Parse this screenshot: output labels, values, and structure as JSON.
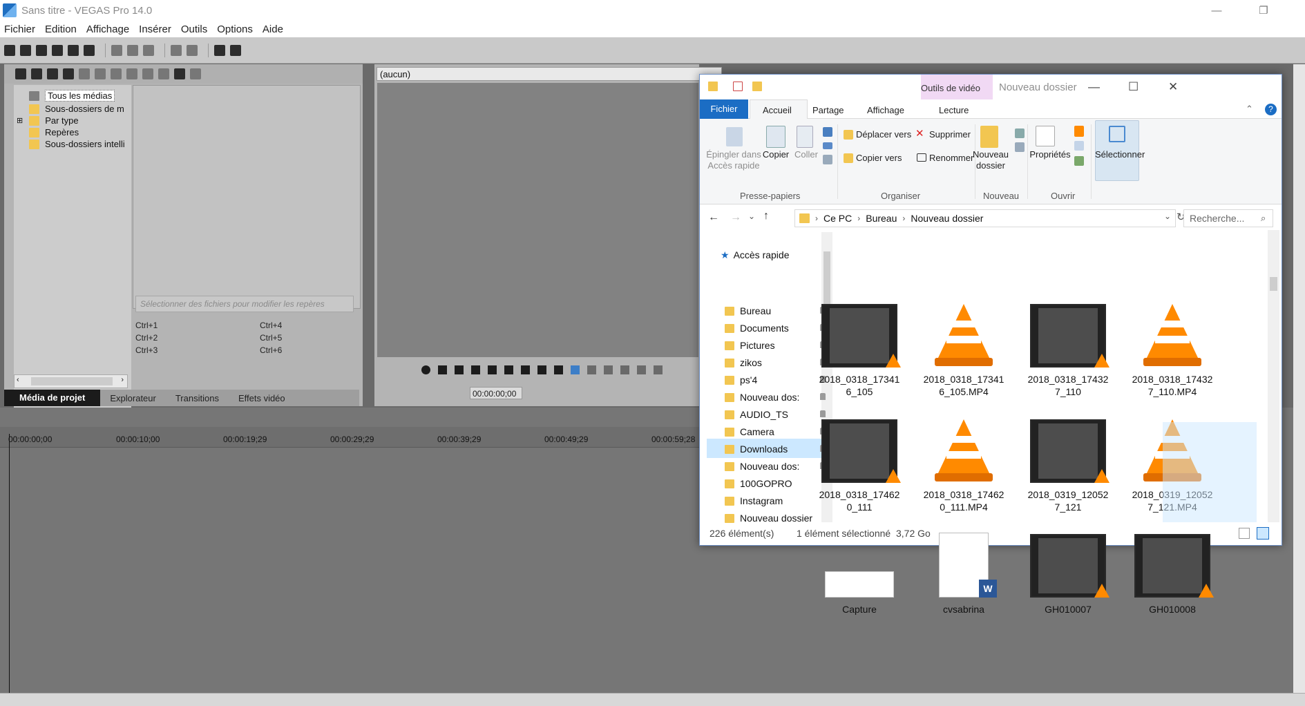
{
  "vegas": {
    "title": "Sans titre - VEGAS Pro 14.0",
    "menu": [
      "Fichier",
      "Edition",
      "Affichage",
      "Insérer",
      "Outils",
      "Options",
      "Aide"
    ],
    "tree": {
      "root": "Tous les médias",
      "items": [
        "Sous-dossiers de m",
        "Par type",
        "Repères",
        "Sous-dossiers intelli"
      ]
    },
    "markers_placeholder": "Sélectionner des fichiers pour modifier les repères",
    "shortcuts": [
      "Ctrl+1",
      "Ctrl+4",
      "Ctrl+2",
      "Ctrl+5",
      "Ctrl+3",
      "Ctrl+6"
    ],
    "tabs": [
      "Média de projet",
      "Explorateur",
      "Transitions",
      "Effets vidéo"
    ],
    "preview_selector": "(aucun)",
    "timecode": "00:00:00;00",
    "ruler": [
      "00:00:00;00",
      "00:00:10;00",
      "00:00:19;29",
      "00:00:29;29",
      "00:00:39;29",
      "00:00:49;29",
      "00:00:59;28"
    ]
  },
  "explorer": {
    "title": "Nouveau dossier",
    "context_tab": "Outils de vidéo",
    "ribbon_tabs": [
      "Fichier",
      "Accueil",
      "Partage",
      "Affichage",
      "Lecture"
    ],
    "ribbon": {
      "pin": "Épingler dans Accès rapide",
      "copy": "Copier",
      "paste": "Coller",
      "move_to": "Déplacer vers",
      "copy_to": "Copier vers",
      "delete": "Supprimer",
      "rename": "Renommer",
      "new_folder": "Nouveau dossier",
      "properties": "Propriétés",
      "select": "Sélectionner",
      "groups": [
        "Presse-papiers",
        "Organiser",
        "Nouveau",
        "Ouvrir"
      ]
    },
    "breadcrumb": [
      "Ce PC",
      "Bureau",
      "Nouveau dossier"
    ],
    "search_placeholder": "Recherche...",
    "nav": {
      "quick_access": "Accès rapide",
      "items": [
        "Bureau",
        "Documents",
        "Pictures",
        "zikos",
        "ps'4",
        "Nouveau dos:",
        "AUDIO_TS",
        "Camera",
        "Downloads",
        "Nouveau dos:",
        "100GOPRO",
        "Instagram",
        "Nouveau dossier"
      ]
    },
    "files": [
      {
        "name": "2018_0318_173416_105",
        "kind": "video-thumb"
      },
      {
        "name": "2018_0318_173416_105.MP4",
        "kind": "vlc"
      },
      {
        "name": "2018_0318_174327_110",
        "kind": "video-thumb"
      },
      {
        "name": "2018_0318_174327_110.MP4",
        "kind": "vlc"
      },
      {
        "name": "2018_0318_174620_111",
        "kind": "video-thumb"
      },
      {
        "name": "2018_0318_174620_111.MP4",
        "kind": "vlc"
      },
      {
        "name": "2018_0319_120527_121",
        "kind": "video-thumb"
      },
      {
        "name": "2018_0319_120527_121.MP4",
        "kind": "vlc"
      },
      {
        "name": "Capture",
        "kind": "image"
      },
      {
        "name": "cvsabrina",
        "kind": "word-doc"
      },
      {
        "name": "GH010007",
        "kind": "video-thumb"
      },
      {
        "name": "GH010008",
        "kind": "video-thumb"
      }
    ],
    "status": {
      "count": "226 élément(s)",
      "selection": "1 élément sélectionné  3,72 Go"
    }
  }
}
